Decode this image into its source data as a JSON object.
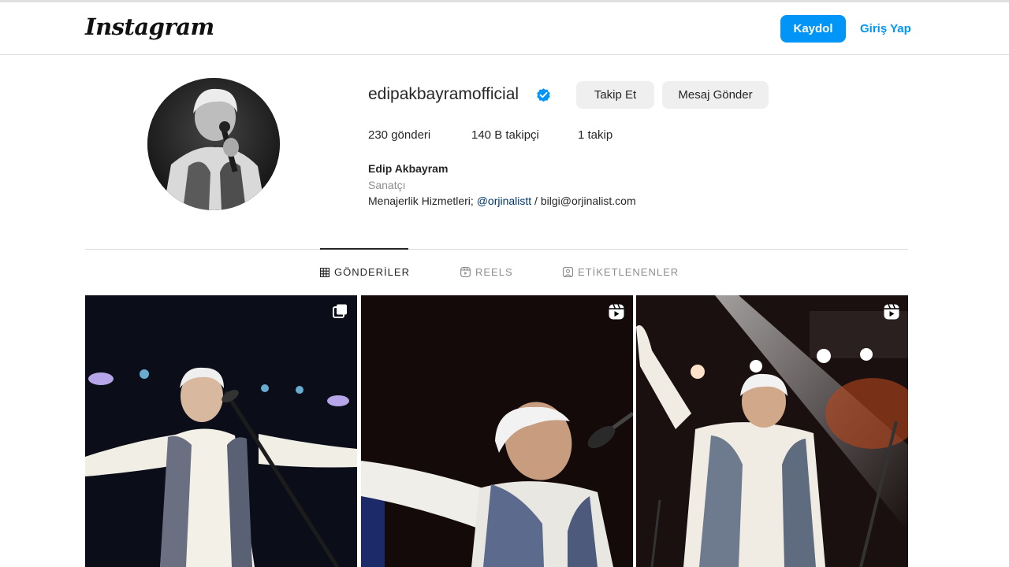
{
  "header": {
    "logo": "Instagram",
    "signup_label": "Kaydol",
    "login_label": "Giriş Yap"
  },
  "profile": {
    "username": "edipakbayramofficial",
    "verified": true,
    "follow_label": "Takip Et",
    "message_label": "Mesaj Gönder",
    "stats": {
      "posts": "230 gönderi",
      "followers": "140 B takipçi",
      "following": "1 takip"
    },
    "full_name": "Edip Akbayram",
    "category": "Sanatçı",
    "bio_prefix": "Menajerlik Hizmetleri; ",
    "bio_mention": "@orjinalistt",
    "bio_suffix": " / bilgi@orjinalist.com"
  },
  "tabs": [
    {
      "label": "GÖNDERİLER",
      "icon": "grid-icon",
      "active": true
    },
    {
      "label": "REELS",
      "icon": "reels-icon",
      "active": false
    },
    {
      "label": "ETİKETLENENLER",
      "icon": "tagged-icon",
      "active": false
    }
  ],
  "posts": [
    {
      "type": "carousel",
      "badge_icon": "carousel-icon"
    },
    {
      "type": "reel",
      "badge_icon": "reel-icon"
    },
    {
      "type": "reel",
      "badge_icon": "reel-icon"
    }
  ],
  "colors": {
    "accent": "#0095f6",
    "verified": "#0095f6",
    "button_bg": "#efefef",
    "mention": "#00376b"
  }
}
